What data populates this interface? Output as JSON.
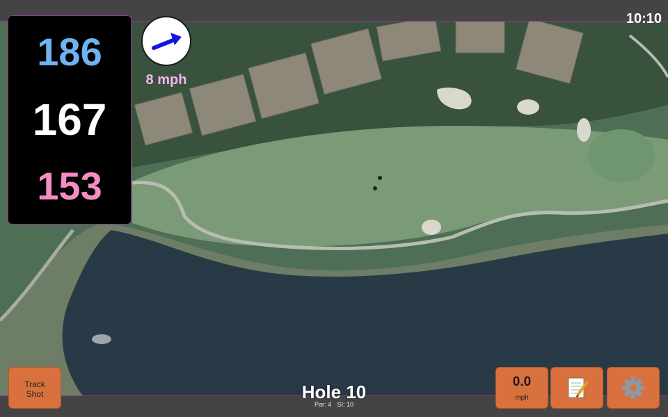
{
  "status_bar": {
    "time": "10:10"
  },
  "distances": {
    "back": "186",
    "middle": "167",
    "front": "153"
  },
  "wind": {
    "speed": "8 mph",
    "direction_icon": "arrow-icon"
  },
  "buttons": {
    "track_shot": {
      "line1": "Track",
      "line2": "Shot"
    },
    "speed": {
      "value": "0.0",
      "unit": "mph"
    },
    "notes_icon": "notepad-icon",
    "settings_icon": "gear-icon"
  },
  "hole": {
    "title": "Hole 10",
    "par": "Par: 4",
    "si": "SI: 10"
  },
  "colors": {
    "back": "#6fb3f0",
    "middle": "#ffffff",
    "front": "#f58cc4",
    "wind_label": "#f3b6f3",
    "button": "#d9713e"
  }
}
